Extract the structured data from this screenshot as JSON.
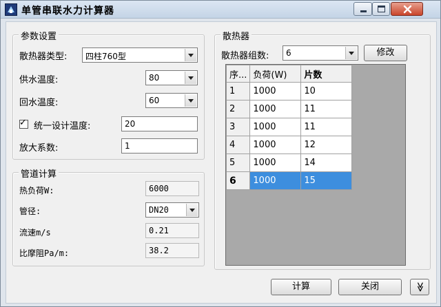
{
  "window": {
    "title": "单管串联水力计算器"
  },
  "params": {
    "legend": "参数设置",
    "radiator_type_label": "散热器类型:",
    "radiator_type_value": "四柱760型",
    "supply_temp_label": "供水温度:",
    "supply_temp_value": "80",
    "return_temp_label": "回水温度:",
    "return_temp_value": "60",
    "unify_label": "统一设计温度:",
    "unify_checked": true,
    "unify_value": "20",
    "scale_label": "放大系数:",
    "scale_value": "1"
  },
  "pipe": {
    "legend": "管道计算",
    "heat_load_label": "热负荷W:",
    "heat_load_value": "6000",
    "diameter_label": "管径:",
    "diameter_value": "DN20",
    "velocity_label": "流速m/s",
    "velocity_value": "0.21",
    "friction_label": "比摩阻Pa/m:",
    "friction_value": "38.2"
  },
  "radiator": {
    "legend": "散热器",
    "count_label": "散热器组数:",
    "count_value": "6",
    "modify_label": "修改",
    "columns": [
      "序...",
      "负荷(W)",
      "片数"
    ],
    "rows": [
      {
        "seq": "1",
        "load": "1000",
        "pieces": "10"
      },
      {
        "seq": "2",
        "load": "1000",
        "pieces": "11"
      },
      {
        "seq": "3",
        "load": "1000",
        "pieces": "11"
      },
      {
        "seq": "4",
        "load": "1000",
        "pieces": "12"
      },
      {
        "seq": "5",
        "load": "1000",
        "pieces": "14"
      },
      {
        "seq": "6",
        "load": "1000",
        "pieces": "15"
      }
    ]
  },
  "footer": {
    "calculate_label": "计算",
    "close_label": "关闭",
    "expand_label": "≫"
  },
  "colors": {
    "selection": "#3d8ede",
    "close_button": "#c9452b"
  }
}
